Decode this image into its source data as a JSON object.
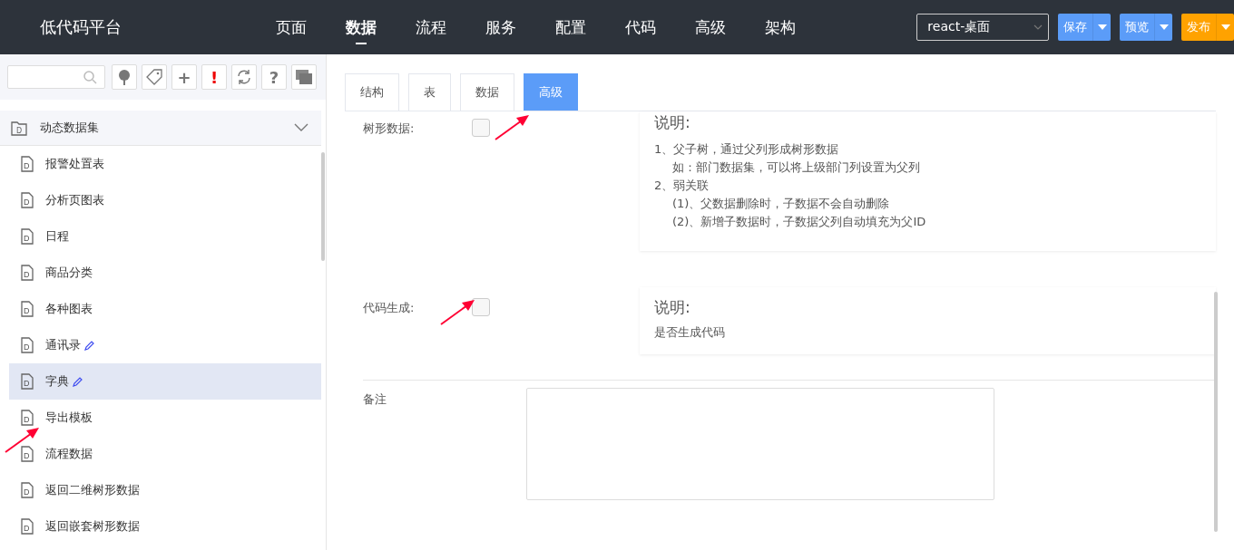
{
  "header": {
    "logo": "低代码平台",
    "nav": [
      {
        "label": "页面",
        "selected": false
      },
      {
        "label": "数据",
        "selected": true
      },
      {
        "label": "流程",
        "selected": false
      },
      {
        "label": "服务",
        "selected": false
      },
      {
        "label": "配置",
        "selected": false
      },
      {
        "label": "代码",
        "selected": false
      },
      {
        "label": "高级",
        "selected": false
      },
      {
        "label": "架构",
        "selected": false
      }
    ],
    "template_select": "react-桌面",
    "buttons": [
      {
        "label": "保存",
        "kind": "primary"
      },
      {
        "label": "预览",
        "kind": "primary"
      },
      {
        "label": "发布",
        "kind": "warning"
      }
    ]
  },
  "sidebar": {
    "toolbar": [
      {
        "kind": "tree"
      },
      {
        "kind": "tag"
      },
      {
        "kind": "plain",
        "text": "+"
      },
      {
        "kind": "alert",
        "text": "!"
      },
      {
        "kind": "refresh"
      },
      {
        "kind": "plain",
        "text": "?"
      },
      {
        "kind": "windows"
      }
    ],
    "group": {
      "label": "动态数据集",
      "expanded": true,
      "icon_text": "D"
    },
    "items": [
      {
        "label": "报警处置表",
        "selected": false,
        "editable": false,
        "icon_text": "D"
      },
      {
        "label": "分析页图表",
        "selected": false,
        "editable": false,
        "icon_text": "D"
      },
      {
        "label": "日程",
        "selected": false,
        "editable": false,
        "icon_text": "D"
      },
      {
        "label": "商品分类",
        "selected": false,
        "editable": false,
        "icon_text": "D"
      },
      {
        "label": "各种图表",
        "selected": false,
        "editable": false,
        "icon_text": "D"
      },
      {
        "label": "通讯录",
        "selected": false,
        "editable": true,
        "icon_text": "D"
      },
      {
        "label": "字典",
        "selected": true,
        "editable": true,
        "icon_text": "D"
      },
      {
        "label": "导出模板",
        "selected": false,
        "editable": false,
        "icon_text": "D"
      },
      {
        "label": "流程数据",
        "selected": false,
        "editable": false,
        "icon_text": "D"
      },
      {
        "label": "返回二维树形数据",
        "selected": false,
        "editable": false,
        "icon_text": "D"
      },
      {
        "label": "返回嵌套树形数据",
        "selected": false,
        "editable": false,
        "icon_text": "D"
      }
    ]
  },
  "tabs": [
    {
      "label": "结构",
      "selected": false
    },
    {
      "label": "表",
      "selected": false
    },
    {
      "label": "数据",
      "selected": false
    },
    {
      "label": "高级",
      "selected": true
    }
  ],
  "options": [
    {
      "label": "树形数据:",
      "checked": false,
      "help_title": "说明:",
      "help_lines": [
        {
          "text": "1、父子树，通过父列形成树形数据",
          "children": [
            {
              "text": "如：部门数据集，可以将上级部门列设置为父列"
            }
          ]
        },
        {
          "text": "2、弱关联",
          "children": [
            {
              "text": "(1)、父数据删除时，子数据不会自动删除"
            },
            {
              "text": "(2)、新增子数据时，子数据父列自动填充为父ID"
            }
          ]
        }
      ]
    },
    {
      "label": "代码生成:",
      "checked": false,
      "help_title": "说明:",
      "help_lines": [
        {
          "text": "是否生成代码"
        }
      ]
    }
  ],
  "note": {
    "label": "备注"
  }
}
